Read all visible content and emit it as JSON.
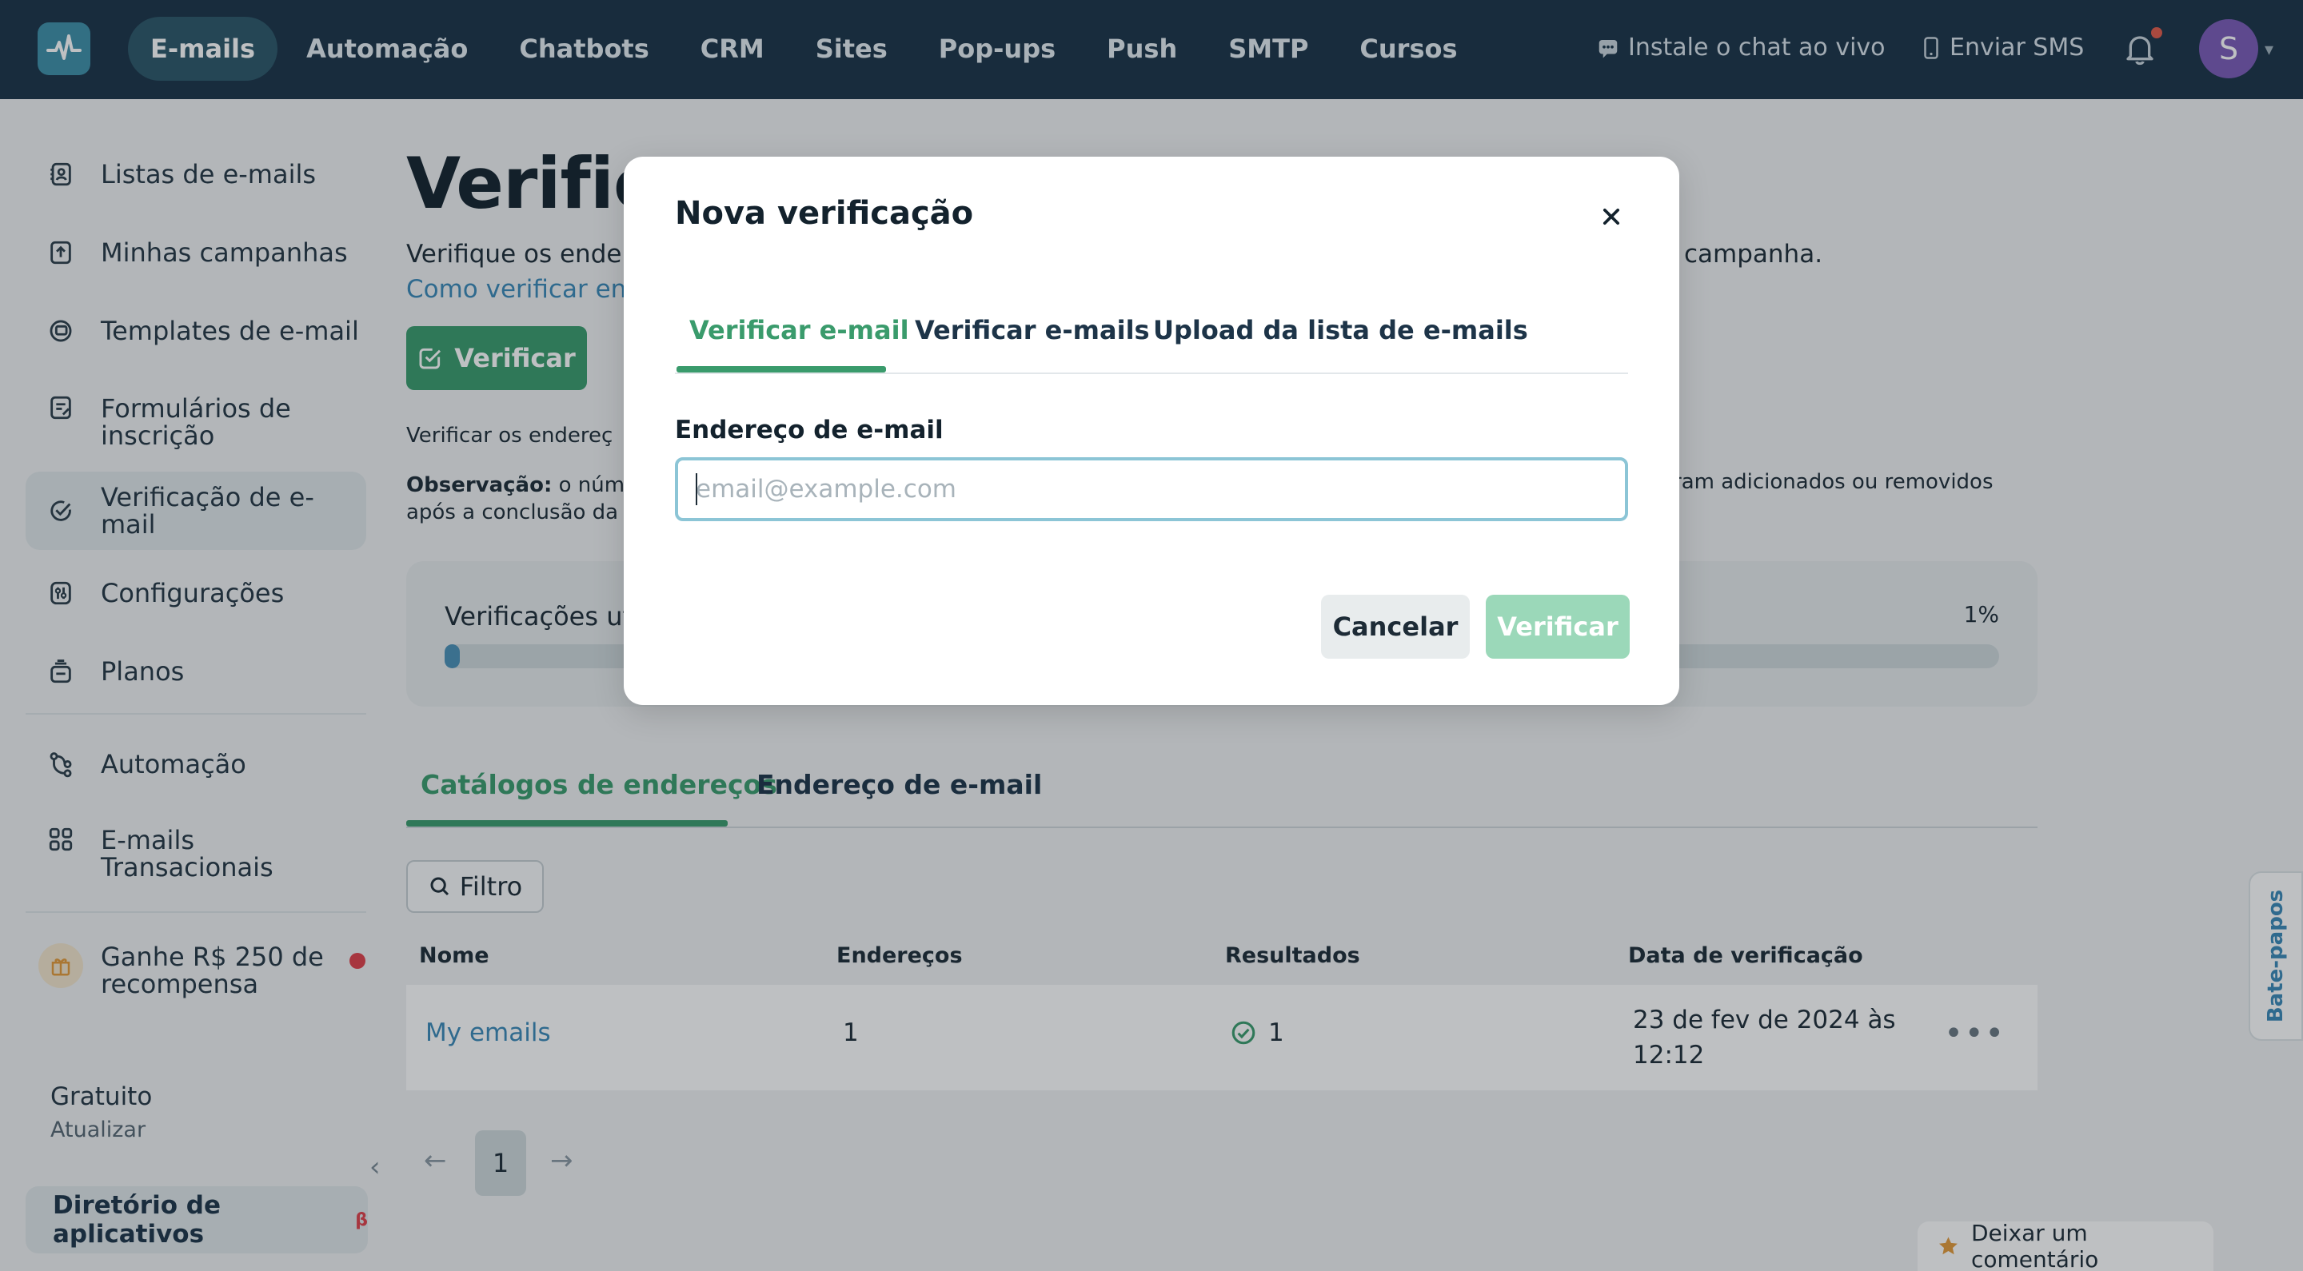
{
  "topnav": {
    "items": [
      "E-mails",
      "Automação",
      "Chatbots",
      "CRM",
      "Sites",
      "Pop-ups",
      "Push",
      "SMTP",
      "Cursos"
    ],
    "active": "E-mails",
    "live_chat": "Instale o chat ao vivo",
    "sms": "Enviar SMS",
    "avatar_initial": "S"
  },
  "sidebar": {
    "items": [
      {
        "label": "Listas de e-mails",
        "icon": "contacts-book-icon"
      },
      {
        "label": "Minhas campanhas",
        "icon": "campaign-upload-icon"
      },
      {
        "label": "Templates de e-mail",
        "icon": "template-icon"
      },
      {
        "label": "Formulários de inscrição",
        "icon": "form-icon"
      },
      {
        "label": "Verificação de e-mail",
        "icon": "check-circle-icon"
      },
      {
        "label": "Configurações",
        "icon": "settings-sliders-icon"
      },
      {
        "label": "Planos",
        "icon": "plans-icon"
      },
      {
        "label": "Automação",
        "icon": "automation-icon"
      },
      {
        "label": "E-mails Transacionais",
        "icon": "grid-icon"
      }
    ],
    "active": "Verificação de e-mail",
    "reward": "Ganhe R$ 250 de recompensa",
    "plan_name": "Gratuito",
    "plan_upgrade": "Atualizar",
    "app_directory": "Diretório de aplicativos",
    "app_directory_badge": "β"
  },
  "main": {
    "title": "Verifica",
    "description": "Verifique os ender",
    "description_tail": "campanha.",
    "how_link": "Como verificar enc",
    "verify_button": "Verificar",
    "verify_text": "Verificar os endereç",
    "note_label": "Observação:",
    "note_text": " o númer",
    "note_tail": "ram adicionados ou removidos",
    "note_line2": "após a conclusão da",
    "usage_label": "Verificações ut",
    "usage_percent": "1%",
    "usage_fraction": 0.01,
    "tabs": [
      "Catálogos de endereços",
      "Endereço de e-mail"
    ],
    "active_tab": "Catálogos de endereços",
    "filter": "Filtro",
    "table": {
      "headers": [
        "Nome",
        "Endereços",
        "Resultados",
        "Data de verificação"
      ],
      "rows": [
        {
          "name": "My emails",
          "addresses": "1",
          "results": "1",
          "date_line1": "23 de fev de 2024 às",
          "date_line2": "12:12"
        }
      ]
    },
    "page": "1",
    "chat_tab": "Bate-papos",
    "feedback": "Deixar um comentário"
  },
  "modal": {
    "title": "Nova verificação",
    "tabs": [
      "Verificar e-mail",
      "Verificar e-mails",
      "Upload da lista de e-mails"
    ],
    "active_tab": "Verificar e-mail",
    "field_label": "Endereço de e-mail",
    "placeholder": "email@example.com",
    "value": "",
    "cancel": "Cancelar",
    "submit": "Verificar"
  },
  "colors": {
    "topbar": "#1a3347",
    "accent_green": "#3a9b6c",
    "link_blue": "#3a88b8",
    "submit_disabled": "#9bd8b9"
  }
}
